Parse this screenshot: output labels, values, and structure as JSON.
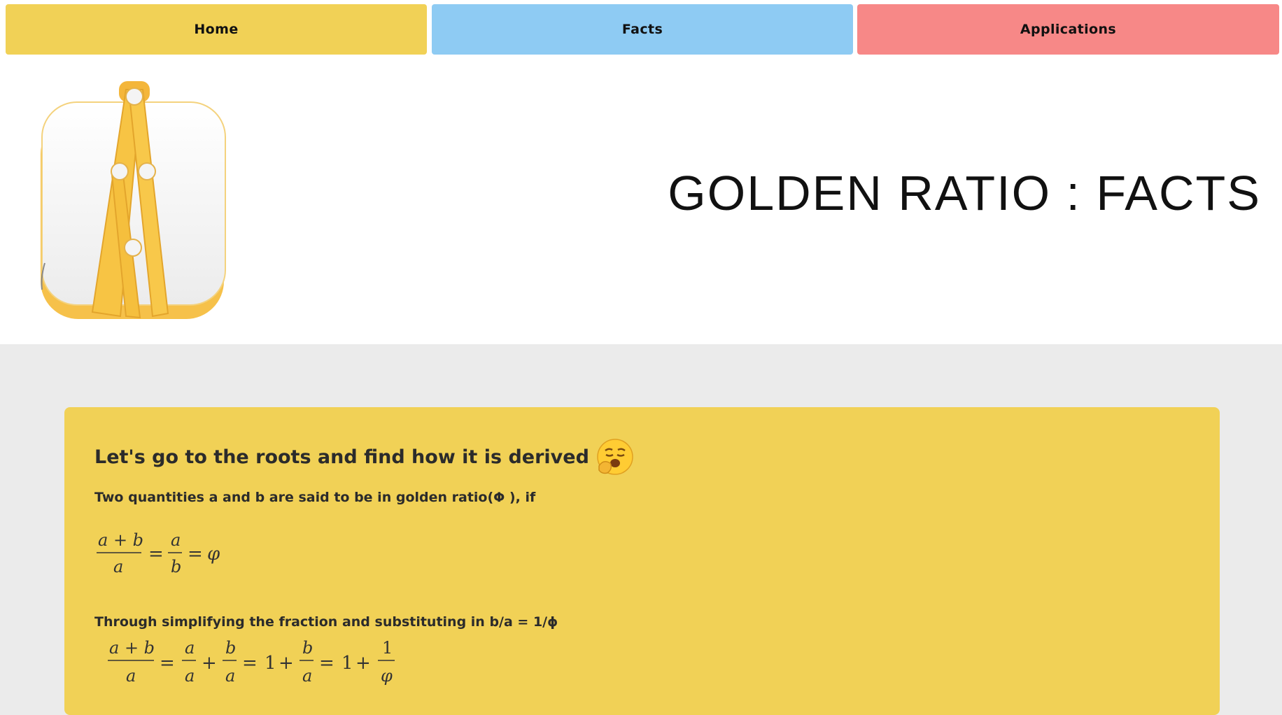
{
  "nav": {
    "home_label": "Home",
    "facts_label": "Facts",
    "applications_label": "Applications",
    "colors": {
      "home": "#f1d156",
      "facts": "#8ecbf3",
      "applications": "#f78887"
    }
  },
  "header": {
    "logo_icon": "golden-ratio-caliper-icon",
    "title": "GOLDEN RATIO : FACTS"
  },
  "content": {
    "heading": "Let's go to the roots and find how it is derived",
    "heading_emoji": "yawning-face-icon",
    "intro_text": "Two quantities a and b are said to be in golden ratio(Φ ), if",
    "equation1": {
      "num1": "a + b",
      "den1": "a",
      "eq": "=",
      "num2": "a",
      "den2": "b",
      "eq2": "=",
      "result": "φ"
    },
    "simplify_text": "Through simplifying the fraction and substituting in b/a = 1/ϕ",
    "equation2": {
      "f1_num": "a + b",
      "f1_den": "a",
      "eq1": "=",
      "f2_num": "a",
      "f2_den": "a",
      "plus1": "+",
      "f3_num": "b",
      "f3_den": "a",
      "eq2": "=",
      "one1": "1",
      "plus2": "+",
      "f4_num": "b",
      "f4_den": "a",
      "eq3": "=",
      "one2": "1",
      "plus3": "+",
      "f5_num": "1",
      "f5_den": "φ"
    },
    "card_color": "#f1d156"
  }
}
